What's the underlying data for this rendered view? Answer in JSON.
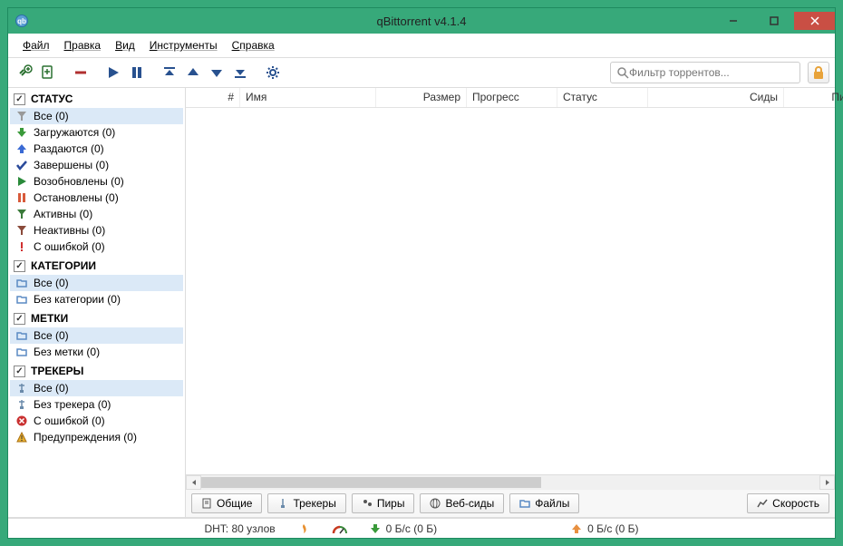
{
  "window": {
    "title": "qBittorrent v4.1.4"
  },
  "menu": {
    "file": "Файл",
    "edit": "Правка",
    "view": "Вид",
    "tools": "Инструменты",
    "help": "Справка"
  },
  "toolbar": {
    "search_placeholder": "Фильтр торрентов..."
  },
  "filters": {
    "status": {
      "header": "СТАТУС",
      "all": "Все (0)",
      "downloading": "Загружаются (0)",
      "seeding": "Раздаются (0)",
      "completed": "Завершены (0)",
      "resumed": "Возобновлены (0)",
      "paused": "Остановлены (0)",
      "active": "Активны (0)",
      "inactive": "Неактивны (0)",
      "error": "С ошибкой (0)"
    },
    "categories": {
      "header": "КАТЕГОРИИ",
      "all": "Все (0)",
      "uncategorized": "Без категории (0)"
    },
    "tags": {
      "header": "МЕТКИ",
      "all": "Все (0)",
      "untagged": "Без метки (0)"
    },
    "trackers": {
      "header": "ТРЕКЕРЫ",
      "all": "Все (0)",
      "trackerless": "Без трекера (0)",
      "error": "С ошибкой (0)",
      "warning": "Предупреждения (0)"
    }
  },
  "columns": {
    "number": "#",
    "name": "Имя",
    "size": "Размер",
    "progress": "Прогресс",
    "status": "Статус",
    "seeds": "Сиды",
    "peers": "Пиры"
  },
  "tabs": {
    "general": "Общие",
    "trackers": "Трекеры",
    "peers": "Пиры",
    "webseeds": "Веб-сиды",
    "files": "Файлы",
    "speed": "Скорость"
  },
  "status": {
    "dht": "DHT: 80 узлов",
    "down": "0 Б/с (0 Б)",
    "up": "0 Б/с (0 Б)"
  }
}
